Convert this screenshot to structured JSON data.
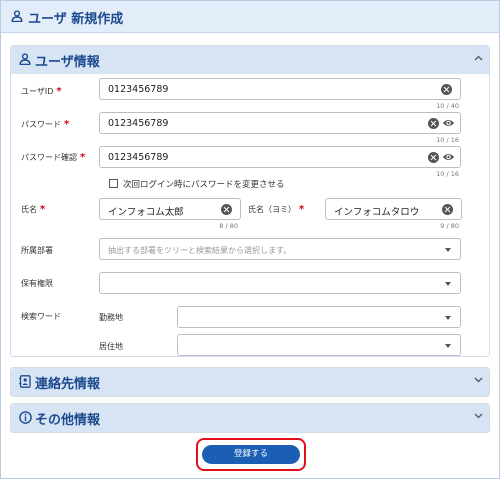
{
  "page": {
    "title": "ユーザ 新規作成"
  },
  "user_info": {
    "title": "ユーザ情報",
    "user_id": {
      "label": "ユーザID",
      "value": "0123456789",
      "count": "10 / 40"
    },
    "password": {
      "label": "パスワード",
      "value": "0123456789",
      "count": "10 / 16"
    },
    "password_confirm": {
      "label": "パスワード確認",
      "value": "0123456789",
      "count": "10 / 16"
    },
    "change_password_next_login": {
      "label": "次回ログイン時にパスワードを変更させる",
      "checked": false
    },
    "name": {
      "label": "氏名",
      "value": "インフォコム太郎",
      "count": "8 / 80"
    },
    "name_kana": {
      "label": "氏名（ヨミ）",
      "value": "インフォコムタロウ",
      "count": "9 / 80"
    },
    "department": {
      "label": "所属部署",
      "placeholder": "抽出する部署をツリーと検索結果から選択します。"
    },
    "permission": {
      "label": "保有権限",
      "value": ""
    },
    "search_word": {
      "label": "検索ワード",
      "work_location": {
        "label": "勤務地",
        "value": ""
      },
      "residence": {
        "label": "居住地",
        "value": ""
      }
    },
    "required_mark": "*"
  },
  "contact_info": {
    "title": "連絡先情報"
  },
  "other_info": {
    "title": "その他情報"
  },
  "actions": {
    "register_label": "登録する"
  },
  "colors": {
    "accent": "#1a5fb4",
    "header_bg": "#d7e4f4",
    "required": "#d0021b",
    "highlight": "#e0101a"
  }
}
